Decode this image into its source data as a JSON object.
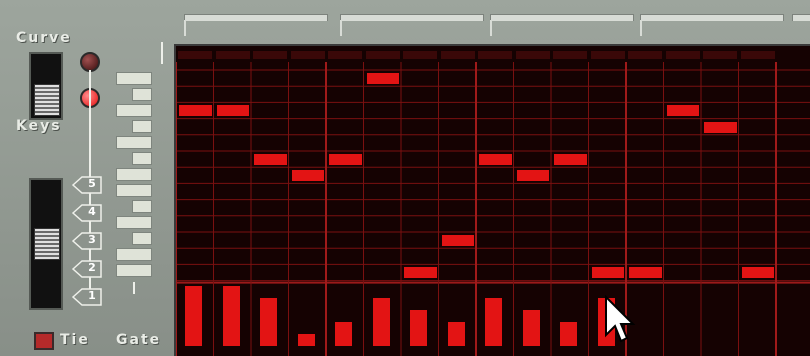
{
  "labels": {
    "curve": "Curve",
    "keys": "Keys",
    "tie": "Tie",
    "gate": "Gate"
  },
  "octave_buttons": [
    "5",
    "4",
    "3",
    "2",
    "1"
  ],
  "steps": [
    {
      "step": 1,
      "note_row": 3,
      "gate": 5
    },
    {
      "step": 2,
      "note_row": 3,
      "gate": 5
    },
    {
      "step": 3,
      "note_row": 6,
      "gate": 4
    },
    {
      "step": 4,
      "note_row": 7,
      "gate": 1
    },
    {
      "step": 5,
      "note_row": 6,
      "gate": 2
    },
    {
      "step": 6,
      "note_row": 1,
      "gate": 4
    },
    {
      "step": 7,
      "note_row": 13,
      "gate": 3
    },
    {
      "step": 8,
      "note_row": 11,
      "gate": 2
    },
    {
      "step": 9,
      "note_row": 6,
      "gate": 4
    },
    {
      "step": 10,
      "note_row": 7,
      "gate": 3
    },
    {
      "step": 11,
      "note_row": 6,
      "gate": 2
    },
    {
      "step": 12,
      "note_row": 13,
      "gate": 4
    },
    {
      "step": 13,
      "note_row": 13,
      "gate": 0
    },
    {
      "step": 14,
      "note_row": 3,
      "gate": 0
    },
    {
      "step": 15,
      "note_row": 4,
      "gate": 0
    },
    {
      "step": 16,
      "note_row": 13,
      "gate": 0
    }
  ],
  "colors": {
    "note": "#e31414",
    "grid_line": "#7a1010",
    "grid_bg": "#150202",
    "panel": "#959c95"
  }
}
